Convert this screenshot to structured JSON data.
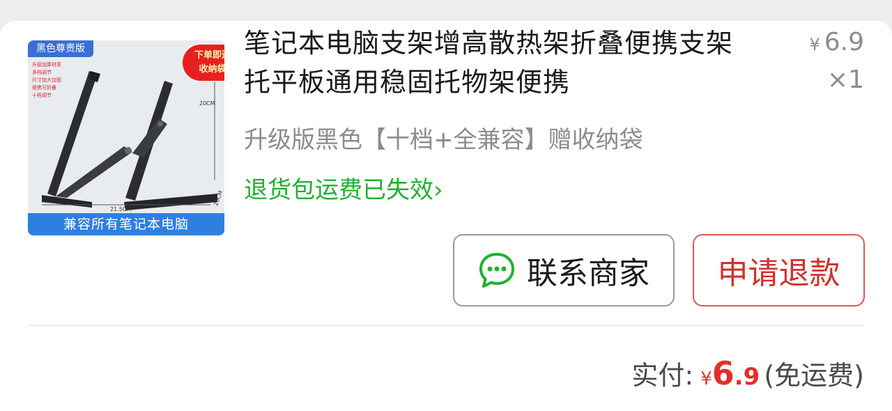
{
  "order_item": {
    "thumbnail": {
      "tag": "黑色尊贵版",
      "badge_line1": "下单即送",
      "badge_line2": "收纳袋",
      "bullets": [
        "升级加厚材质",
        "多档调节",
        "尺寸加大加宽",
        "便携可折叠",
        "十档调节"
      ],
      "dim_height": "20CM",
      "dim_width": "21.5CM",
      "dim_depth": "26CM",
      "footer": "兼容所有笔记本电脑"
    },
    "title": "笔记本电脑支架增高散热架折叠便携支架托平板通用稳固托物架便携",
    "sku": "升级版黑色【十档+全兼容】赠收纳袋",
    "return_link": "退货包运费已失效",
    "return_link_chevron": "›",
    "unit_price_symbol": "¥",
    "unit_price": "6.9",
    "quantity": "×1"
  },
  "actions": {
    "contact_label": "联系商家",
    "refund_label": "申请退款"
  },
  "summary": {
    "label": "实付:",
    "symbol": "¥",
    "amount_int": "6",
    "amount_dec": ".9",
    "note": "(免运费)"
  },
  "icons": {
    "contact": "chat-bubble-icon",
    "chevron": "chevron-right-icon"
  },
  "colors": {
    "accent_green": "#20b030",
    "refund_red": "#d0312d",
    "price_red": "#e0302a"
  }
}
